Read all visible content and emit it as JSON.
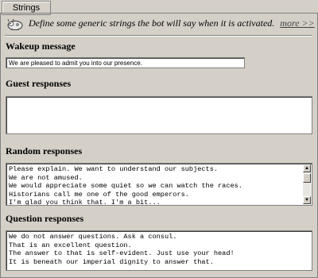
{
  "tab": {
    "label": "Strings"
  },
  "info": {
    "description": "Define some generic strings the bot will say when it is activated.",
    "more_link": "more >>"
  },
  "wakeup": {
    "label": "Wakeup message",
    "value": "We are pleased to admit you into our presence."
  },
  "guest": {
    "label": "Guest responses",
    "lines": []
  },
  "random": {
    "label": "Random responses",
    "lines": [
      "Please explain. We want to understand our subjects.",
      "We are not amused.",
      "We would appreciate some quiet so we can watch the races.",
      "Historians call me one of the good emperors.",
      "I'm glad you think that. I'm a bit..."
    ]
  },
  "question": {
    "label": "Question responses",
    "lines": [
      "We do not answer questions. Ask a consul.",
      "That is an excellent question.",
      "The answer to that is self-evident. Just use your head!",
      "It is beneath our imperial dignity to answer that."
    ]
  }
}
